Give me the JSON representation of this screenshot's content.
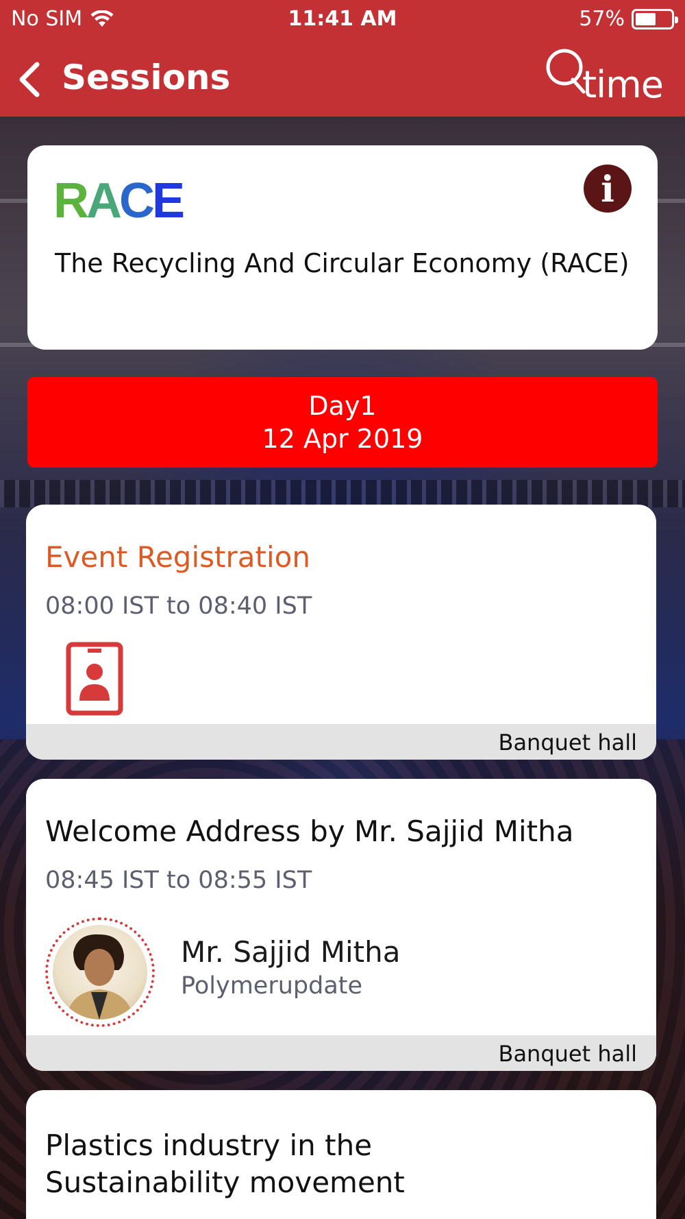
{
  "status_bar": {
    "carrier": "No SIM",
    "time": "11:41 AM",
    "battery": "57%"
  },
  "nav": {
    "title": "Sessions",
    "logo_text": "time"
  },
  "header": {
    "logo": {
      "r": "R",
      "a": "A",
      "c": "C",
      "e": "E"
    },
    "event_name": "The Recycling And Circular Economy (RACE)"
  },
  "day": {
    "label": "Day1",
    "date": "12 Apr 2019"
  },
  "sessions": [
    {
      "title": "Event Registration",
      "time": "08:00 IST  to 08:40 IST",
      "venue": "Banquet hall",
      "icon": "id-badge-icon"
    },
    {
      "title": "Welcome Address by Mr. Sajjid Mitha",
      "time": "08:45 IST  to 08:55 IST",
      "speaker_name": "Mr. Sajjid Mitha",
      "speaker_org": "Polymerupdate",
      "venue": "Banquet hall"
    },
    {
      "title_line1": "Plastics industry in the",
      "title_line2": "Sustainability movement"
    }
  ],
  "colors": {
    "nav_bar": "#c43134",
    "day_banner": "#ff0000",
    "registration_title": "#de5a24",
    "info_button": "#5b1516"
  }
}
